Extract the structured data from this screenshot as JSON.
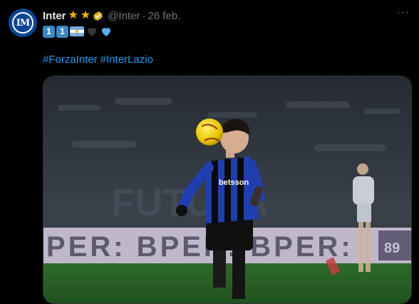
{
  "tweet": {
    "author_name": "Inter",
    "author_logo_text": "IM",
    "handle": "@Inter",
    "separator": "·",
    "date": "26 feb.",
    "more_label": "···",
    "emoji_keys": [
      "1",
      "1"
    ],
    "hashtags": [
      "#ForzaInter",
      "#InterLazio"
    ],
    "media": {
      "description": "Inter player running toward the ball in a match photo",
      "board_text": "PER: BPER: BPER:",
      "kit_sponsor": "betsson",
      "board_right": "89",
      "stand_text": "FUTURA"
    }
  },
  "colors": {
    "background": "#000000",
    "text": "#e7e9ea",
    "muted": "#71767b",
    "link": "#1d9bf0",
    "star": "#f5b800",
    "inter_blue": "#0a4595"
  }
}
